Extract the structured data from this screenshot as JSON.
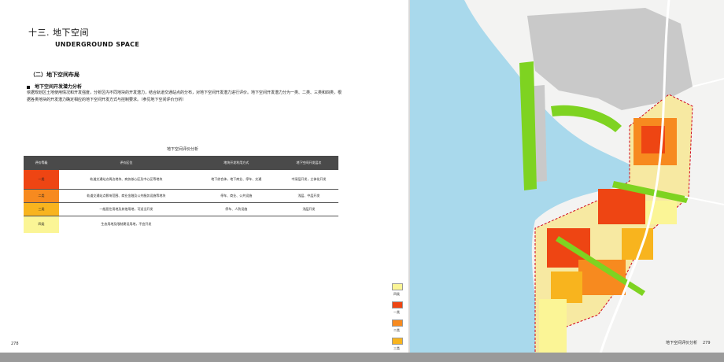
{
  "chapter": {
    "title": "十三. 地下空间",
    "subtitle": "UNDERGROUND SPACE"
  },
  "section": {
    "title": "（二）地下空间布局",
    "subsection": "地下空间开发潜力分析",
    "paragraph": "依据规划区土地使用情况和开发强度，分析区内不同地块的开发潜力，结合轨道交通站点的分布，对地下空间开发潜力进行评价。地下空间开发潜力分为一类、二类、三类和四类，根据各类地块的开发潜力确定相应的地下空间开发方式与控制要求。（参见地下空间评价分析）"
  },
  "table": {
    "caption": "地下空间评价分析",
    "headers": [
      "评价等级",
      "评价区位",
      "地块开发利用方式",
      "地下空间开发层次"
    ],
    "rows": [
      {
        "level": "一类",
        "area": "轨道交通站点周边地块、商务核心区及中心区等地块",
        "mode": "地下综合体，地下商业、停车、交通",
        "depth": "中深层开发，立体化开发"
      },
      {
        "level": "二类",
        "area": "轨道交通站点影响范围、商业金融及公共服务设施等地块",
        "mode": "停车、商业、公共设施",
        "depth": "浅层、中层开发"
      },
      {
        "level": "三类",
        "area": "一般居住用地及其他用地，可适当开发",
        "mode": "停车、人防设施",
        "depth": "浅层开发"
      },
      {
        "level": "四类",
        "area": "生态用地及限制建设用地，不宜开发",
        "mode": "",
        "depth": ""
      }
    ]
  },
  "legend": [
    {
      "label": "四类",
      "color": "#fbf596"
    },
    {
      "label": "一类",
      "color": "#ee4513"
    },
    {
      "label": "二类",
      "color": "#f78a1f"
    },
    {
      "label": "三类",
      "color": "#f8b41e"
    }
  ],
  "map": {
    "caption": "地下空间评价分析",
    "water_color": "#a9d9ec",
    "land_color": "#f3f3f2",
    "built_color": "#c9c9c9",
    "green_color": "#7ed321",
    "boundary_color": "#d0021b"
  },
  "page_numbers": {
    "left": "278",
    "right": "279"
  }
}
